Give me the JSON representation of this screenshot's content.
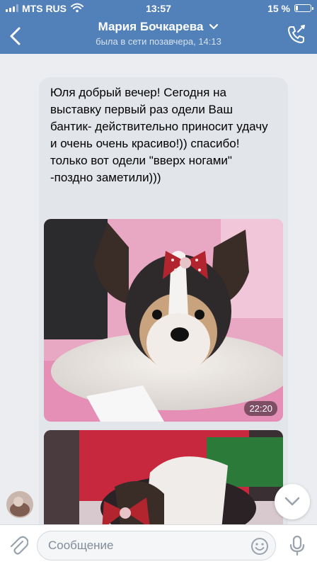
{
  "status_bar": {
    "carrier": "MTS RUS",
    "time": "13:57",
    "battery_percent": "15 %",
    "battery_level": 0.15,
    "signal_bars": 3
  },
  "header": {
    "contact_name": "Мария Бочкарева",
    "last_seen": "была в сети позавчера, 14:13"
  },
  "messages": [
    {
      "text": "Юля добрый вечер! Сегодня на выставку первый раз одели Ваш бантик- действительно приносит удачу и очень очень красиво!)) спасибо! только вот одели \"вверх ногами\" -поздно заметили)))",
      "photos": [
        {
          "time": "22:20"
        },
        {
          "time": ""
        }
      ]
    }
  ],
  "composer": {
    "placeholder": "Сообщение"
  },
  "icons": {
    "back": "chevron-left-icon",
    "title_dropdown": "chevron-down-icon",
    "call": "phone-call-icon",
    "attach": "paperclip-icon",
    "emoji": "emoji-icon",
    "mic": "microphone-icon",
    "scroll_down": "chevron-down-icon"
  },
  "colors": {
    "header": "#5181b8",
    "chat_background": "#ebedf0",
    "bubble": "#e2e5ea",
    "accent": "#5181b8"
  }
}
